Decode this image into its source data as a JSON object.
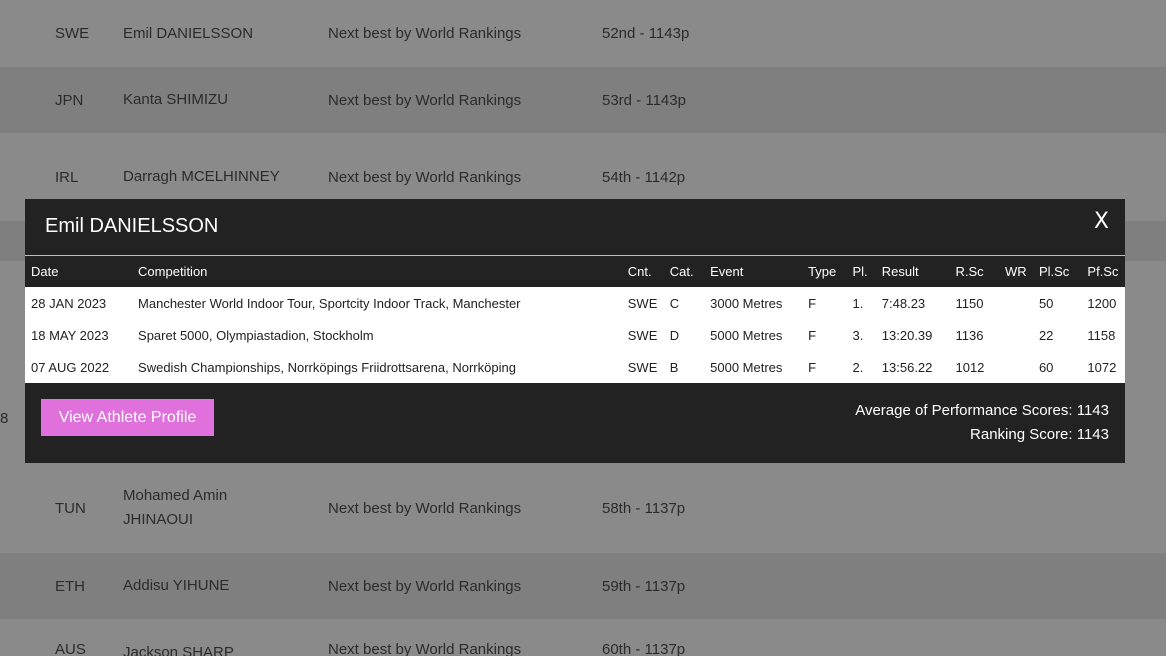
{
  "background_rows": [
    {
      "country": "SWE",
      "name": "Emil DANIELSSON",
      "reason": "Next best by World Rankings",
      "rank": "52nd - 1143p"
    },
    {
      "country": "JPN",
      "name": "Kanta SHIMIZU",
      "reason": "Next best by World Rankings",
      "rank": "53rd - 1143p"
    },
    {
      "country": "IRL",
      "name": "Darragh MCELHINNEY",
      "reason": "Next best by World Rankings",
      "rank": "54th - 1142p"
    },
    {
      "country": "TUN",
      "name": "Mohamed Amin JHINAOUI",
      "reason": "Next best by World Rankings",
      "rank": "58th - 1137p"
    },
    {
      "country": "ETH",
      "name": "Addisu YIHUNE",
      "reason": "Next best by World Rankings",
      "rank": "59th - 1137p"
    },
    {
      "country": "AUS",
      "name": "Jackson SHARP",
      "reason": "Next best by World Rankings",
      "rank": "60th - 1137p"
    }
  ],
  "edge_glyph": "8",
  "modal": {
    "title": "Emil DANIELSSON",
    "close_label": "X",
    "columns": [
      "Date",
      "Competition",
      "Cnt.",
      "Cat.",
      "Event",
      "Type",
      "Pl.",
      "Result",
      "R.Sc",
      "WR",
      "Pl.Sc",
      "Pf.Sc"
    ],
    "rows": [
      [
        "28 JAN 2023",
        "Manchester World Indoor Tour, Sportcity Indoor Track, Manchester",
        "SWE",
        "C",
        "3000 Metres",
        "F",
        "1.",
        "7:48.23",
        "1150",
        "",
        "50",
        "1200"
      ],
      [
        "18 MAY 2023",
        "Sparet 5000, Olympiastadion, Stockholm",
        "SWE",
        "D",
        "5000 Metres",
        "F",
        "3.",
        "13:20.39",
        "1136",
        "",
        "22",
        "1158"
      ],
      [
        "07 AUG 2022",
        "Swedish Championships, Norrköpings Friidrottsarena, Norrköping",
        "SWE",
        "B",
        "5000 Metres",
        "F",
        "2.",
        "13:56.22",
        "1012",
        "",
        "60",
        "1072"
      ]
    ],
    "profile_button_label": "View Athlete Profile",
    "average_label": "Average of Performance Scores: 1143",
    "ranking_label": "Ranking Score: 1143"
  },
  "colors": {
    "overlay_bg": "#8a8a8a",
    "modal_bg": "#222222",
    "accent_button": "#e070dc"
  }
}
